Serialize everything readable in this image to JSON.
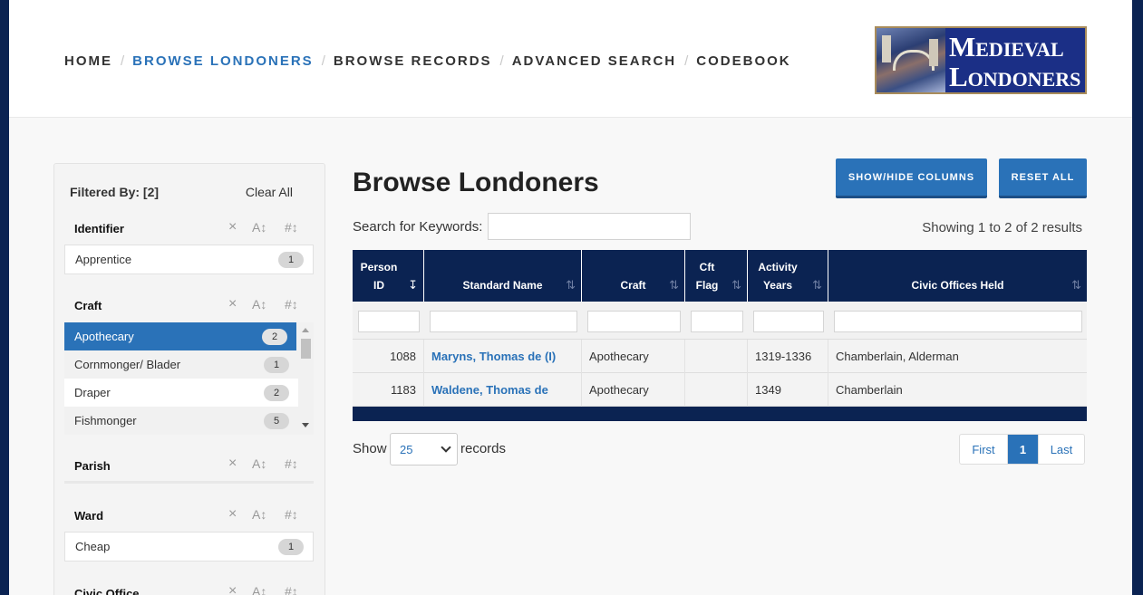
{
  "nav": {
    "items": [
      "HOME",
      "BROWSE LONDONERS",
      "BROWSE RECORDS",
      "ADVANCED SEARCH",
      "CODEBOOK"
    ],
    "active_index": 1
  },
  "logo": {
    "line1": "Medieval",
    "line2": "Londoners"
  },
  "sidebar": {
    "filtered_by": "Filtered By: [2]",
    "clear_all": "Clear All",
    "tools": {
      "clear": "×",
      "alpha_sort": "A↕",
      "num_sort": "#↕"
    },
    "facets": [
      {
        "title": "Identifier",
        "items": [
          {
            "label": "Apprentice",
            "count": "1"
          }
        ]
      },
      {
        "title": "Craft",
        "items": [
          {
            "label": "Apothecary",
            "count": "2",
            "selected": true
          },
          {
            "label": "Cornmonger/ Blader",
            "count": "1"
          },
          {
            "label": "Draper",
            "count": "2"
          },
          {
            "label": "Fishmonger",
            "count": "5"
          }
        ]
      },
      {
        "title": "Parish",
        "items": []
      },
      {
        "title": "Ward",
        "items": [
          {
            "label": "Cheap",
            "count": "1"
          }
        ]
      },
      {
        "title": "Civic Office",
        "items": []
      }
    ]
  },
  "main": {
    "title": "Browse Londoners",
    "show_hide_button": "SHOW/HIDE COLUMNS",
    "reset_button": "RESET ALL",
    "search_label": "Search for Keywords:",
    "search_value": "",
    "showing": "Showing 1 to 2 of 2 results",
    "columns": [
      {
        "line1": "Person",
        "line2": "ID"
      },
      {
        "line1": "Standard Name",
        "line2": ""
      },
      {
        "line1": "Craft",
        "line2": ""
      },
      {
        "line1": "Cft",
        "line2": "Flag"
      },
      {
        "line1": "Activity",
        "line2": "Years"
      },
      {
        "line1": "Civic Offices Held",
        "line2": ""
      }
    ],
    "sort_glyph": "⇅",
    "sort_active_glyph": "↧",
    "rows": [
      {
        "id": "1088",
        "name": "Maryns, Thomas de (I)",
        "craft": "Apothecary",
        "flag": "",
        "years": "1319-1336",
        "offices": "Chamberlain, Alderman"
      },
      {
        "id": "1183",
        "name": "Waldene, Thomas de",
        "craft": "Apothecary",
        "flag": "",
        "years": "1349",
        "offices": "Chamberlain"
      }
    ],
    "show_label": "Show",
    "page_size": "25",
    "records_label": "records",
    "pager": [
      "First",
      "1",
      "Last"
    ]
  }
}
